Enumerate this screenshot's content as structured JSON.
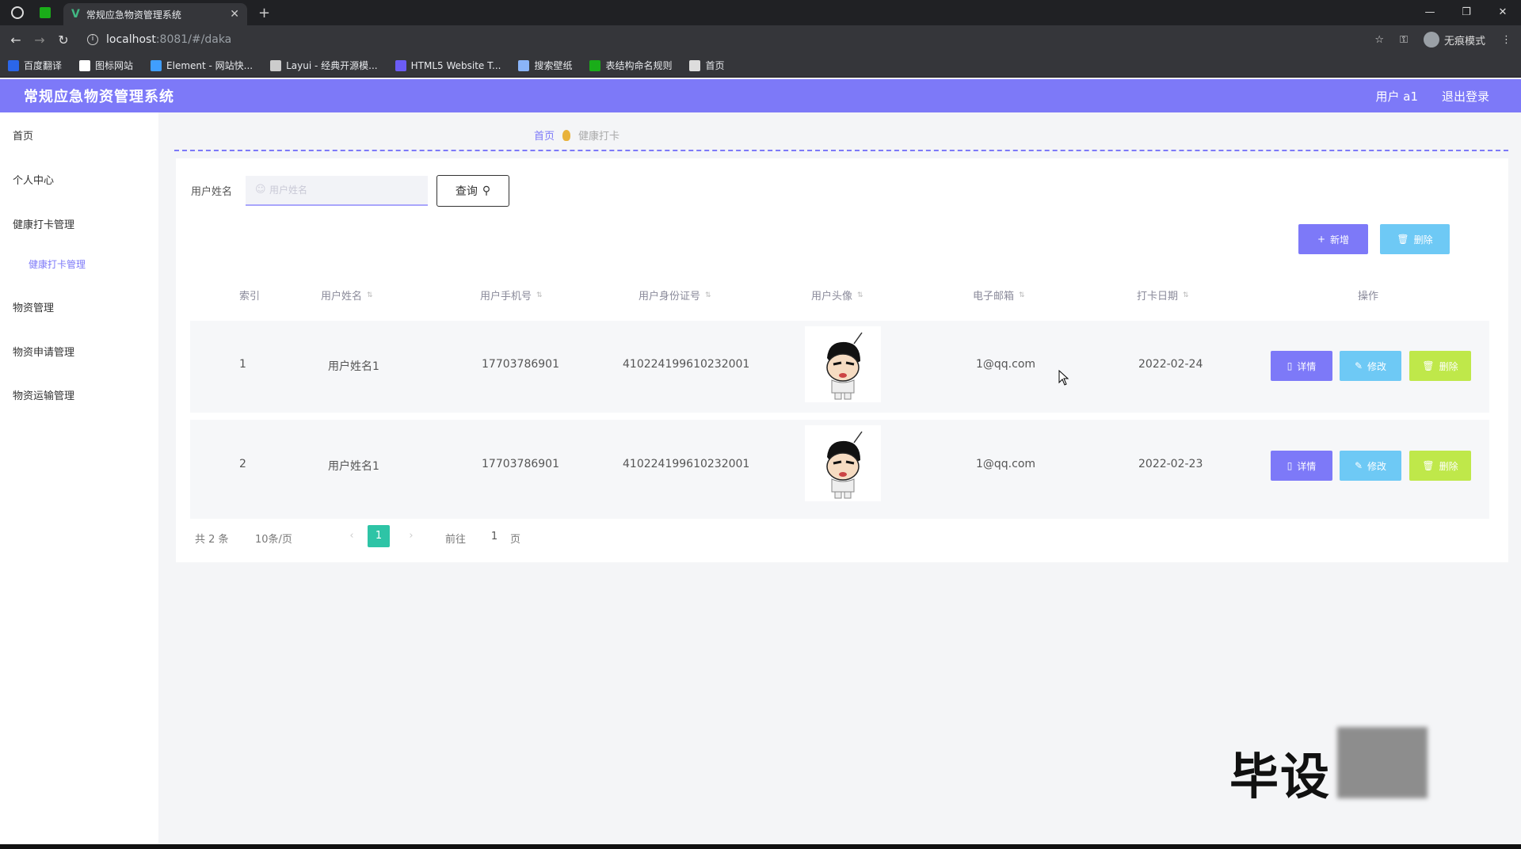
{
  "browser": {
    "tab_title": "常规应急物资管理系统",
    "tab_close": "✕",
    "new_tab": "+",
    "url_host": "localhost",
    "url_rest": ":8081/#/daka",
    "incognito_label": "无痕模式",
    "bookmarks": [
      {
        "label": "百度翻译",
        "color": "#2b66e8"
      },
      {
        "label": "图标网站",
        "color": "#ffffff"
      },
      {
        "label": "Element - 网站快...",
        "color": "#409eff"
      },
      {
        "label": "Layui - 经典开源模...",
        "color": "#cccccc"
      },
      {
        "label": "HTML5 Website T...",
        "color": "#6b5cf5"
      },
      {
        "label": "搜索壁纸",
        "color": "#8ab4f8"
      },
      {
        "label": "表结构命名规则",
        "color": "#1aad19"
      },
      {
        "label": "首页",
        "color": "#dddddd"
      }
    ]
  },
  "header": {
    "title": "常规应急物资管理系统",
    "user": "用户 a1",
    "logout": "退出登录"
  },
  "sidebar": {
    "items": [
      "首页",
      "个人中心",
      "健康打卡管理",
      "物资管理",
      "物资申请管理",
      "物资运输管理"
    ],
    "sub_item": "健康打卡管理"
  },
  "breadcrumb": {
    "home": "首页",
    "current": "健康打卡"
  },
  "search": {
    "label": "用户姓名",
    "placeholder": "用户姓名",
    "button": "查询"
  },
  "actions": {
    "add": "新增",
    "delete": "删除"
  },
  "table": {
    "columns": [
      "索引",
      "用户姓名",
      "用户手机号",
      "用户身份证号",
      "用户头像",
      "电子邮箱",
      "打卡日期",
      "操作"
    ],
    "rows": [
      {
        "index": "1",
        "name": "用户姓名1",
        "phone": "17703786901",
        "idcard": "410224199610232001",
        "email": "1@qq.com",
        "date": "2022-02-24"
      },
      {
        "index": "2",
        "name": "用户姓名1",
        "phone": "17703786901",
        "idcard": "410224199610232001",
        "email": "1@qq.com",
        "date": "2022-02-23"
      }
    ],
    "row_actions": {
      "detail": "详情",
      "edit": "修改",
      "delete": "删除"
    }
  },
  "pagination": {
    "total": "共 2 条",
    "page_size": "10条/页",
    "current": "1",
    "goto": "前往",
    "goto_value": "1",
    "page": "页"
  },
  "watermark": "毕设"
}
